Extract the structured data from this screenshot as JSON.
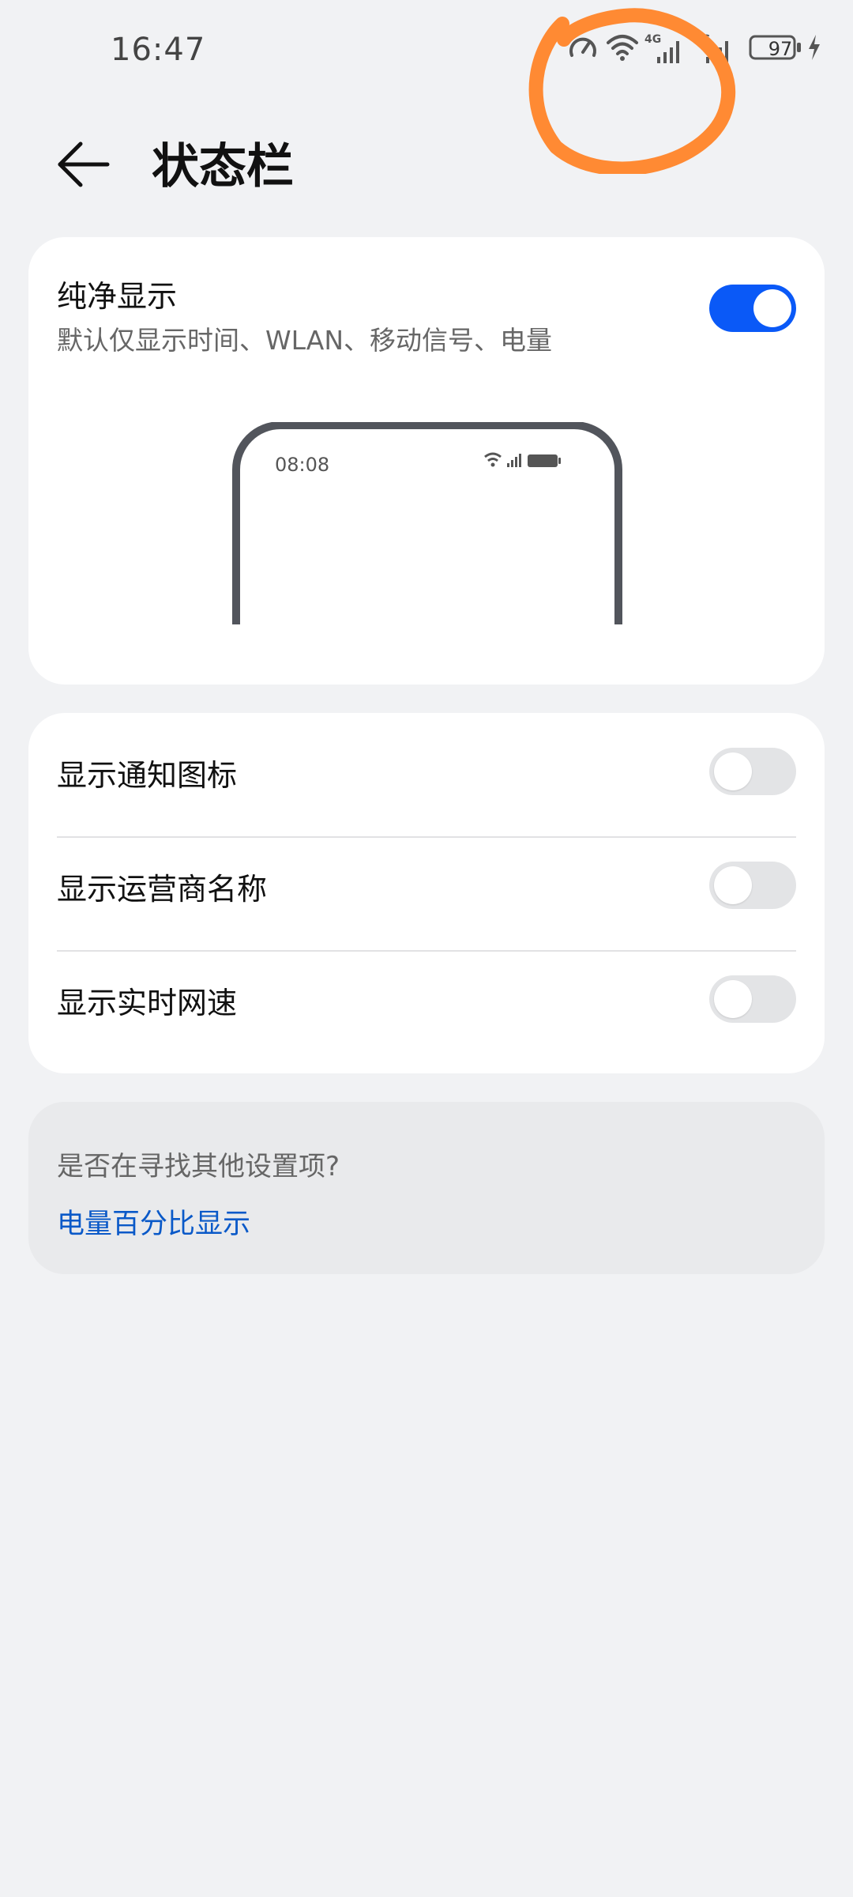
{
  "status_bar": {
    "time": "16:47",
    "battery_level": "97",
    "network_labels": [
      "4G",
      "5G"
    ],
    "icons": [
      "speed-meter-icon",
      "wifi-icon",
      "signal-4g-icon",
      "signal-5g-icon",
      "battery-icon",
      "charging-icon"
    ]
  },
  "header": {
    "title": "状态栏",
    "back_icon": "arrow-left-icon"
  },
  "pure_display": {
    "title": "纯净显示",
    "subtitle": "默认仅显示时间、WLAN、移动信号、电量",
    "enabled": true,
    "preview_time": "08:08"
  },
  "options": [
    {
      "label": "显示通知图标",
      "enabled": false
    },
    {
      "label": "显示运营商名称",
      "enabled": false
    },
    {
      "label": "显示实时网速",
      "enabled": false
    }
  ],
  "suggestion": {
    "question": "是否在寻找其他设置项?",
    "link": "电量百分比显示"
  },
  "colors": {
    "accent": "#0a59f7",
    "link": "#0a59c8",
    "annotation": "#ff8a33",
    "background": "#f1f2f4"
  }
}
